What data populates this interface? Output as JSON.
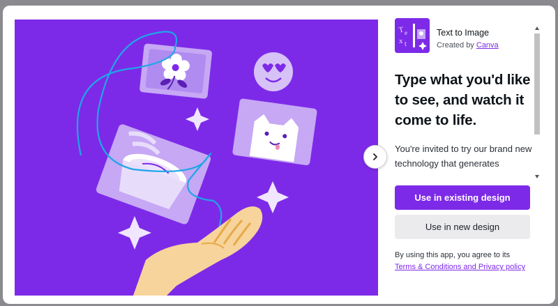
{
  "app": {
    "name": "Text to Image",
    "created_by_prefix": "Created by ",
    "creator": "Canva"
  },
  "headline": "Type what you'd like to see, and watch it come to life.",
  "description": "You're invited to try our brand new technology that generates",
  "buttons": {
    "primary": "Use in existing design",
    "secondary": "Use in new design"
  },
  "terms": {
    "prefix": "By using this app, you agree to its",
    "link": "Terms & Conditions and Privacy policy"
  },
  "colors": {
    "brand": "#7d2ae8",
    "secondary_button": "#ebebee"
  },
  "icons": {
    "next": "chevron-right-icon"
  }
}
